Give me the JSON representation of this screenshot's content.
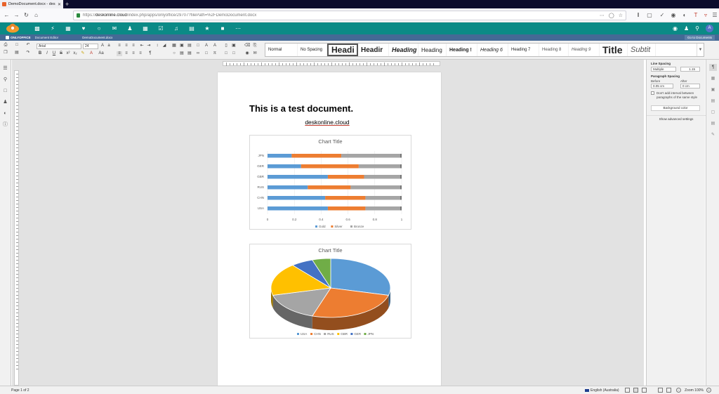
{
  "browser": {
    "tab_title": "DemoDocument.docx - deskonline.cloud",
    "tab_close": "✕",
    "new_tab": "+",
    "url_prefix": "https://",
    "url_domain": "deskonline.cloud",
    "url_rest": "/index.php/apps/onlyoffice/29707?filePath=%2FDemoDocument.docx"
  },
  "onlyoffice": {
    "brand": "ONLYOFFICE",
    "editor": "Document Editor",
    "doc_name": "DemoDocument.docx",
    "goto_docs": "Go to Documents"
  },
  "toolbar": {
    "font_name": "Arial",
    "font_size": "24",
    "styles": [
      "Normal",
      "No Spacing",
      "Headi",
      "Headir",
      "Heading",
      "Heading",
      "Heading !",
      "Heading 6",
      "Heading 7",
      "Heading 8",
      "Heading 9",
      "Title",
      "Subtit"
    ]
  },
  "document": {
    "title": "This is a test document.",
    "link": "deskonline.cloud"
  },
  "chart_data": [
    {
      "type": "bar",
      "orientation": "horizontal",
      "stacked": "100%",
      "title": "Chart Title",
      "categories": [
        "USA",
        "CHN",
        "RUS",
        "GBR",
        "GER",
        "JPN"
      ],
      "series": [
        {
          "name": "Gold",
          "color": "#5b9bd5",
          "values": [
            0.45,
            0.43,
            0.3,
            0.45,
            0.25,
            0.18
          ]
        },
        {
          "name": "Silver",
          "color": "#ed7d31",
          "values": [
            0.28,
            0.3,
            0.32,
            0.27,
            0.43,
            0.37
          ]
        },
        {
          "name": "Bronze",
          "color": "#a5a5a5",
          "values": [
            0.27,
            0.27,
            0.38,
            0.28,
            0.32,
            0.45
          ]
        }
      ],
      "xlim": [
        0,
        1
      ],
      "xticks": [
        "0",
        "0.2",
        "0.4",
        "0.6",
        "0.8",
        "1"
      ],
      "legend": "bottom"
    },
    {
      "type": "pie",
      "style": "3d",
      "title": "Chart Title",
      "categories": [
        "USA",
        "CHN",
        "RUS",
        "GBR",
        "GER",
        "JPN"
      ],
      "colors": [
        "#5b9bd5",
        "#ed7d31",
        "#a5a5a5",
        "#ffc000",
        "#4472c4",
        "#70ad47"
      ],
      "values": [
        29,
        26,
        16,
        18,
        6,
        5
      ],
      "legend": "bottom"
    }
  ],
  "right_panel": {
    "line_spacing": "Line Spacing",
    "ls_mode": "Multiple",
    "ls_value": "1.15",
    "para_spacing": "Paragraph Spacing",
    "before": "Before",
    "after": "After",
    "before_val": "0.05 cm",
    "after_val": "0 cm",
    "dont_add": "Don't add interval between paragraphs of the same style",
    "bg_color": "Background color",
    "advanced": "Show advanced settings"
  },
  "status": {
    "page": "Page 1 of 2",
    "language": "English (Australia)",
    "zoom": "Zoom 100%"
  }
}
